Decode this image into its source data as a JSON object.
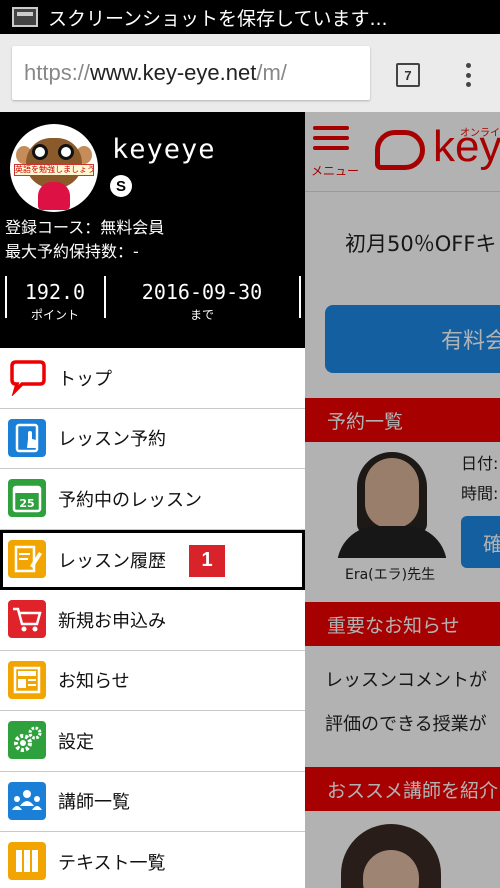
{
  "statusbar": {
    "notification": "スクリーンショットを保存しています..."
  },
  "browser": {
    "url_scheme": "https://",
    "url_host": "www.key-eye.net",
    "url_path": "/m/",
    "tab_count": "7"
  },
  "profile": {
    "username": "keyeye",
    "course": "登録コース：無料会員",
    "max_reservations": "最大予約保持数：-",
    "points_value": "192.0",
    "points_label": "ポイント",
    "expiry_value": "2016-09-30",
    "expiry_label": "まで",
    "avatar_banner": "英語を勉強しましょう"
  },
  "menu": {
    "items": [
      {
        "label": "トップ",
        "icon": "speech-bubble-icon"
      },
      {
        "label": "レッスン予約",
        "icon": "tablet-touch-icon"
      },
      {
        "label": "予約中のレッスン",
        "icon": "calendar-icon"
      },
      {
        "label": "レッスン履歴",
        "icon": "notepad-pencil-icon",
        "badge": "1"
      },
      {
        "label": "新規お申込み",
        "icon": "cart-icon"
      },
      {
        "label": "お知らせ",
        "icon": "news-icon"
      },
      {
        "label": "設定",
        "icon": "gears-icon"
      },
      {
        "label": "講師一覧",
        "icon": "teachers-icon"
      },
      {
        "label": "テキスト一覧",
        "icon": "books-icon"
      }
    ]
  },
  "background_page": {
    "menu_label": "メニュー",
    "brand": "key",
    "brand_sub": "オンライン",
    "promo": "初月50％OFFキ",
    "paid_button": "有料会",
    "reservations_heading": "予約一覧",
    "teacher_name": "Era(エラ)先生",
    "date_label": "日付:",
    "time_label": "時間:",
    "confirm_button": "確",
    "notice_heading": "重要なお知らせ",
    "notice_line1": "レッスンコメントが",
    "notice_line2": "評価のできる授業が",
    "recommend_heading": "おススメ講師を紹介"
  },
  "colors": {
    "accent_red": "#e00000",
    "blue": "#1e88e5",
    "badge_red": "#d8232a"
  }
}
